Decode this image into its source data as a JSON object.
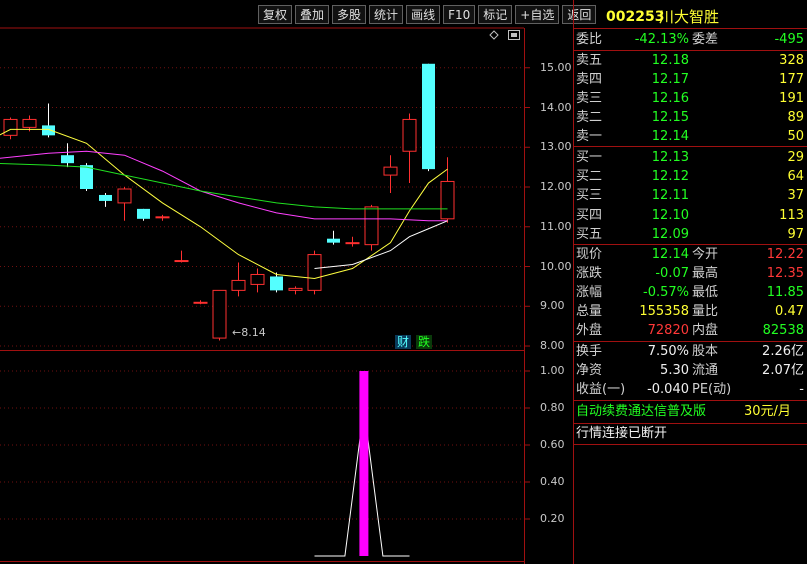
{
  "toolbar": {
    "items": [
      "复权",
      "叠加",
      "多股",
      "统计",
      "画线",
      "F10",
      "标记",
      "+自选",
      "返回"
    ]
  },
  "stock": {
    "code": "002253",
    "name": "川大智胜"
  },
  "commission": {
    "ratio_label": "委比",
    "ratio": "-42.13%",
    "diff_label": "委差",
    "diff": "-495"
  },
  "asks": [
    {
      "label": "卖五",
      "price": "12.18",
      "vol": "328"
    },
    {
      "label": "卖四",
      "price": "12.17",
      "vol": "177"
    },
    {
      "label": "卖三",
      "price": "12.16",
      "vol": "191"
    },
    {
      "label": "卖二",
      "price": "12.15",
      "vol": "89"
    },
    {
      "label": "卖一",
      "price": "12.14",
      "vol": "50"
    }
  ],
  "bids": [
    {
      "label": "买一",
      "price": "12.13",
      "vol": "29"
    },
    {
      "label": "买二",
      "price": "12.12",
      "vol": "64"
    },
    {
      "label": "买三",
      "price": "12.11",
      "vol": "37"
    },
    {
      "label": "买四",
      "price": "12.10",
      "vol": "113"
    },
    {
      "label": "买五",
      "price": "12.09",
      "vol": "97"
    }
  ],
  "quote": [
    {
      "l1": "现价",
      "v1": "12.14",
      "c1": "green",
      "l2": "今开",
      "v2": "12.22",
      "c2": "red"
    },
    {
      "l1": "涨跌",
      "v1": "-0.07",
      "c1": "green",
      "l2": "最高",
      "v2": "12.35",
      "c2": "red"
    },
    {
      "l1": "涨幅",
      "v1": "-0.57%",
      "c1": "green",
      "l2": "最低",
      "v2": "11.85",
      "c2": "green"
    },
    {
      "l1": "总量",
      "v1": "155358",
      "c1": "yellow",
      "l2": "量比",
      "v2": "0.47",
      "c2": "yellow"
    },
    {
      "l1": "外盘",
      "v1": "72820",
      "c1": "red",
      "l2": "内盘",
      "v2": "82538",
      "c2": "green"
    }
  ],
  "finance": [
    {
      "l1": "换手",
      "v1": "7.50%",
      "l2": "股本",
      "v2": "2.26亿"
    },
    {
      "l1": "净资",
      "v1": "5.30",
      "l2": "流通",
      "v2": "2.07亿"
    },
    {
      "l1": "收益(一)",
      "v1": "-0.040",
      "l2": "PE(动)",
      "v2": "-"
    }
  ],
  "promo": {
    "text": "自动续费通达信普及版",
    "price": "30元/月"
  },
  "status": "行情连接已断开",
  "main_axis": [
    "15.00",
    "14.00",
    "13.00",
    "12.00",
    "11.00",
    "10.00",
    "9.00",
    "8.00"
  ],
  "sub_axis": [
    "1.00",
    "0.80",
    "0.60",
    "0.40",
    "0.20"
  ],
  "low_marker": "8.14",
  "badges": {
    "cai": "财",
    "die": "跌"
  },
  "colors": {
    "up": "#ff3030",
    "down": "#54ffff",
    "ma1": "#ffffff",
    "ma2": "#ffff40",
    "ma3": "#ff40ff",
    "ma4": "#20e020",
    "grid": "#a01010"
  },
  "chart_data": {
    "type": "candlestick",
    "ylim": [
      7.9,
      16.0
    ],
    "candles": [
      {
        "o": 13.3,
        "h": 13.75,
        "l": 13.2,
        "c": 13.7
      },
      {
        "o": 13.5,
        "h": 13.8,
        "l": 13.4,
        "c": 13.7
      },
      {
        "o": 13.55,
        "h": 14.1,
        "l": 13.25,
        "c": 13.3
      },
      {
        "o": 12.8,
        "h": 13.1,
        "l": 12.5,
        "c": 12.6
      },
      {
        "o": 12.55,
        "h": 12.6,
        "l": 11.9,
        "c": 11.95
      },
      {
        "o": 11.8,
        "h": 11.85,
        "l": 11.5,
        "c": 11.65
      },
      {
        "o": 11.6,
        "h": 12.0,
        "l": 11.15,
        "c": 11.95
      },
      {
        "o": 11.45,
        "h": 11.45,
        "l": 11.15,
        "c": 11.2
      },
      {
        "o": 11.25,
        "h": 11.3,
        "l": 11.15,
        "c": 11.25
      },
      {
        "o": 10.15,
        "h": 10.4,
        "l": 10.1,
        "c": 10.15
      },
      {
        "o": 9.1,
        "h": 9.15,
        "l": 9.05,
        "c": 9.1
      },
      {
        "o": 8.2,
        "h": 9.4,
        "l": 8.14,
        "c": 9.4
      },
      {
        "o": 9.4,
        "h": 10.1,
        "l": 9.25,
        "c": 9.65
      },
      {
        "o": 9.55,
        "h": 9.95,
        "l": 9.35,
        "c": 9.8
      },
      {
        "o": 9.75,
        "h": 9.85,
        "l": 9.35,
        "c": 9.4
      },
      {
        "o": 9.4,
        "h": 9.5,
        "l": 9.3,
        "c": 9.45
      },
      {
        "o": 9.4,
        "h": 10.4,
        "l": 9.3,
        "c": 10.3
      },
      {
        "o": 10.7,
        "h": 10.9,
        "l": 10.55,
        "c": 10.6
      },
      {
        "o": 10.6,
        "h": 10.75,
        "l": 10.5,
        "c": 10.6
      },
      {
        "o": 10.55,
        "h": 11.55,
        "l": 10.4,
        "c": 11.5
      },
      {
        "o": 12.3,
        "h": 12.8,
        "l": 11.85,
        "c": 12.5
      },
      {
        "o": 12.9,
        "h": 13.85,
        "l": 12.1,
        "c": 13.7
      },
      {
        "o": 15.1,
        "h": 15.1,
        "l": 12.4,
        "c": 12.45
      },
      {
        "o": 11.2,
        "h": 12.75,
        "l": 11.1,
        "c": 12.14
      }
    ],
    "ma_series": [
      {
        "color": "ma2",
        "values": [
          [
            -1,
            13.2
          ],
          [
            0,
            13.45
          ],
          [
            2,
            13.45
          ],
          [
            4,
            13.1
          ],
          [
            6,
            12.3
          ],
          [
            8,
            11.6
          ],
          [
            10,
            11.0
          ],
          [
            12,
            10.3
          ],
          [
            14,
            9.8
          ],
          [
            16,
            9.7
          ],
          [
            18,
            9.95
          ],
          [
            20,
            10.6
          ],
          [
            21,
            11.4
          ],
          [
            22,
            12.1
          ],
          [
            23,
            12.45
          ]
        ]
      },
      {
        "color": "ma3",
        "values": [
          [
            -1,
            12.7
          ],
          [
            2,
            12.85
          ],
          [
            4,
            12.9
          ],
          [
            6,
            12.8
          ],
          [
            8,
            12.4
          ],
          [
            10,
            11.9
          ],
          [
            12,
            11.6
          ],
          [
            14,
            11.35
          ],
          [
            16,
            11.2
          ],
          [
            18,
            11.2
          ],
          [
            20,
            11.2
          ],
          [
            22,
            11.15
          ],
          [
            23,
            11.15
          ]
        ]
      },
      {
        "color": "ma4",
        "values": [
          [
            -1,
            12.6
          ],
          [
            2,
            12.55
          ],
          [
            4,
            12.5
          ],
          [
            6,
            12.3
          ],
          [
            8,
            12.1
          ],
          [
            10,
            11.9
          ],
          [
            12,
            11.75
          ],
          [
            14,
            11.6
          ],
          [
            16,
            11.5
          ],
          [
            18,
            11.45
          ],
          [
            20,
            11.45
          ],
          [
            22,
            11.45
          ],
          [
            23,
            11.45
          ]
        ]
      },
      {
        "color": "ma1",
        "values": [
          [
            16,
            9.95
          ],
          [
            18,
            10.05
          ],
          [
            20,
            10.4
          ],
          [
            21,
            10.75
          ],
          [
            22,
            10.95
          ],
          [
            23,
            11.15
          ]
        ]
      }
    ],
    "indicator": {
      "ylim": [
        0,
        1.0
      ],
      "line": [
        [
          16,
          0
        ],
        [
          17.6,
          0
        ],
        [
          18.6,
          0.8
        ],
        [
          19.6,
          0
        ],
        [
          21,
          0
        ]
      ],
      "bar": {
        "x": 18.6,
        "value": 1.0
      }
    }
  }
}
